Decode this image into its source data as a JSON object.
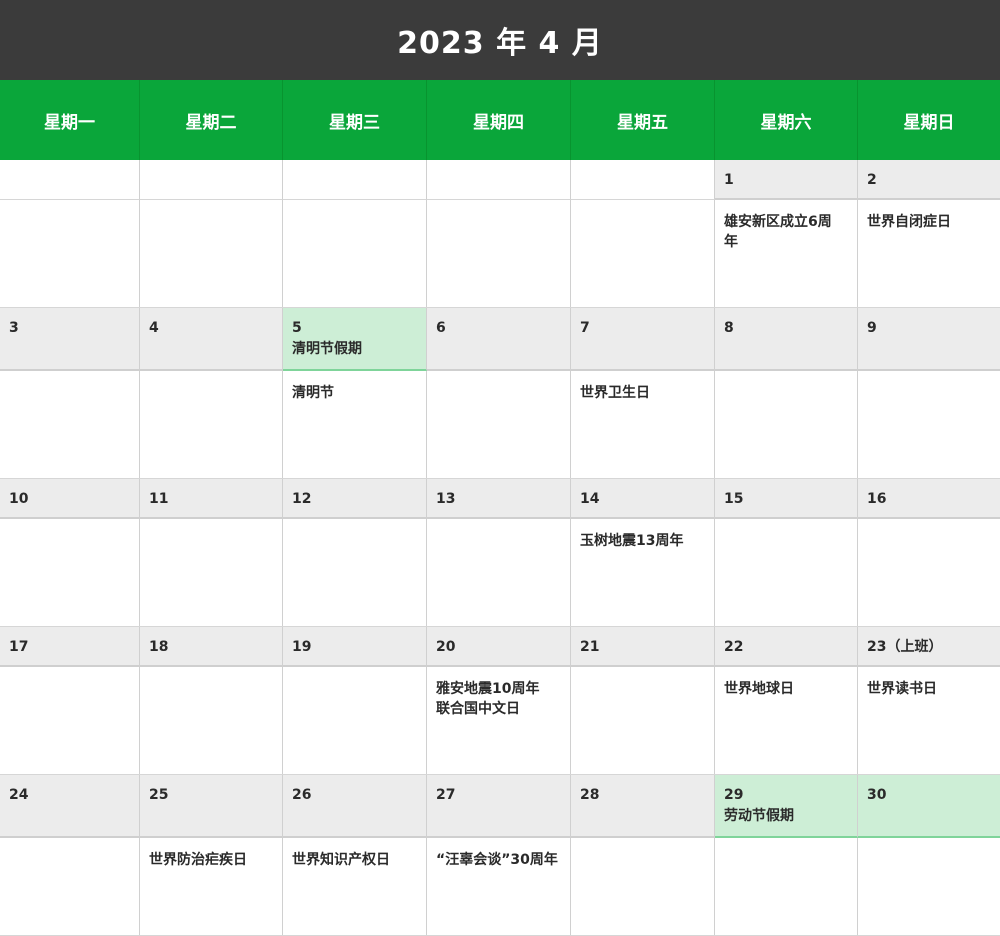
{
  "header": {
    "title": "2023 年 4 月"
  },
  "weekdays": [
    "星期一",
    "星期二",
    "星期三",
    "星期四",
    "星期五",
    "星期六",
    "星期日"
  ],
  "weeks": [
    {
      "days": [
        {
          "date": "",
          "holiday": "",
          "events": []
        },
        {
          "date": "",
          "holiday": "",
          "events": []
        },
        {
          "date": "",
          "holiday": "",
          "events": []
        },
        {
          "date": "",
          "holiday": "",
          "events": []
        },
        {
          "date": "",
          "holiday": "",
          "events": []
        },
        {
          "date": "1",
          "holiday": "",
          "events": [
            "雄安新区成立6周",
            "年"
          ]
        },
        {
          "date": "2",
          "holiday": "",
          "events": [
            "世界自闭症日"
          ]
        }
      ]
    },
    {
      "days": [
        {
          "date": "3",
          "holiday": "",
          "events": []
        },
        {
          "date": "4",
          "holiday": "",
          "events": []
        },
        {
          "date": "5",
          "holiday": "清明节假期",
          "events": [
            "清明节"
          ]
        },
        {
          "date": "6",
          "holiday": "",
          "events": []
        },
        {
          "date": "7",
          "holiday": "",
          "events": [
            "世界卫生日"
          ]
        },
        {
          "date": "8",
          "holiday": "",
          "events": []
        },
        {
          "date": "9",
          "holiday": "",
          "events": []
        }
      ]
    },
    {
      "days": [
        {
          "date": "10",
          "holiday": "",
          "events": []
        },
        {
          "date": "11",
          "holiday": "",
          "events": []
        },
        {
          "date": "12",
          "holiday": "",
          "events": []
        },
        {
          "date": "13",
          "holiday": "",
          "events": []
        },
        {
          "date": "14",
          "holiday": "",
          "events": [
            "玉树地震13周年"
          ]
        },
        {
          "date": "15",
          "holiday": "",
          "events": []
        },
        {
          "date": "16",
          "holiday": "",
          "events": []
        }
      ]
    },
    {
      "days": [
        {
          "date": "17",
          "holiday": "",
          "events": []
        },
        {
          "date": "18",
          "holiday": "",
          "events": []
        },
        {
          "date": "19",
          "holiday": "",
          "events": []
        },
        {
          "date": "20",
          "holiday": "",
          "events": [
            "雅安地震10周年",
            "联合国中文日"
          ]
        },
        {
          "date": "21",
          "holiday": "",
          "events": []
        },
        {
          "date": "22",
          "holiday": "",
          "events": [
            "世界地球日"
          ]
        },
        {
          "date": "23（上班）",
          "holiday": "",
          "events": [
            "世界读书日"
          ]
        }
      ]
    },
    {
      "days": [
        {
          "date": "24",
          "holiday": "",
          "events": []
        },
        {
          "date": "25",
          "holiday": "",
          "events": [
            "世界防治疟疾日"
          ]
        },
        {
          "date": "26",
          "holiday": "",
          "events": [
            "世界知识产权日"
          ]
        },
        {
          "date": "27",
          "holiday": "",
          "events": [
            "“汪辜会谈”30周年"
          ]
        },
        {
          "date": "28",
          "holiday": "",
          "events": []
        },
        {
          "date": "29",
          "holiday": "劳动节假期",
          "events": []
        },
        {
          "date": "30",
          "holiday": "",
          "events": []
        }
      ]
    }
  ],
  "highlight": {
    "holiday_cells": [
      "5",
      "29",
      "30"
    ]
  },
  "colors": {
    "title_bg": "#3b3b3b",
    "weekday_bg": "#0aa63a",
    "date_row_bg": "#ececec",
    "holiday_bg": "#cdeed6"
  }
}
